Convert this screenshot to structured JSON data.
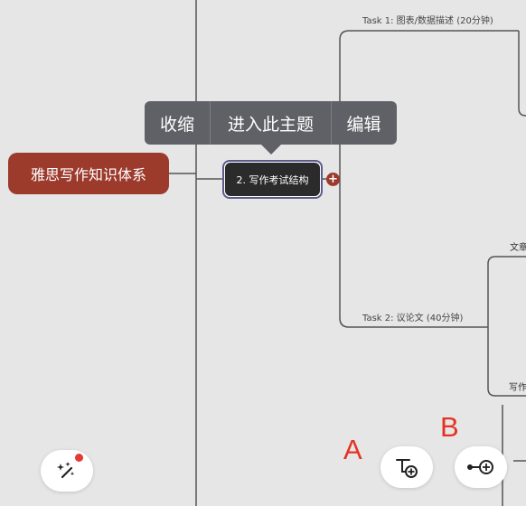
{
  "root_topic": {
    "label": "雅思写作知识体系"
  },
  "selected_topic": {
    "label": "2. 写作考试结构"
  },
  "context_menu": {
    "items": [
      "收缩",
      "进入此主题",
      "编辑"
    ]
  },
  "branches": {
    "task1": "Task 1: 图表/数据描述 (20分钟)",
    "task2": "Task 2: 议论文 (40分钟)",
    "partial_1": "文章",
    "partial_2": "写作"
  },
  "annotations": {
    "a": "A",
    "b": "B"
  },
  "toolbar": {
    "magic_icon": "magic-wand-icon",
    "subtopic_icon": "add-subtopic-icon",
    "sibling_icon": "add-sibling-topic-icon"
  },
  "colors": {
    "root": "#9c3a2c",
    "selected": "#2b2b2b",
    "menu": "#5f6166",
    "badge": "#e53935",
    "annotation": "#e53323"
  }
}
